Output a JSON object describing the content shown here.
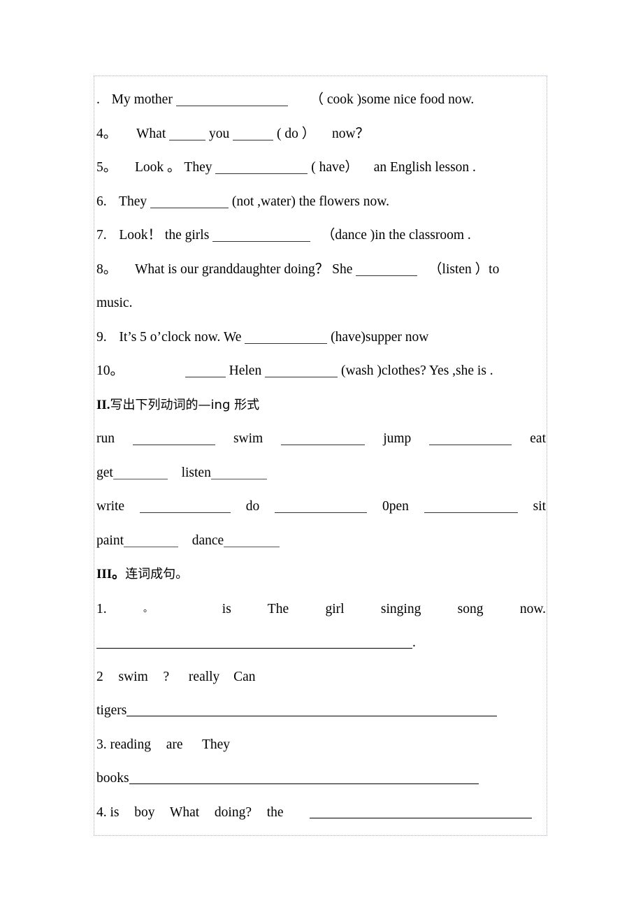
{
  "document": {
    "type": "english-grammar-worksheet",
    "background_color": "#ffffff",
    "text_color": "#000000",
    "border_color": "#b0a8b9"
  },
  "section_one": {
    "items": [
      {
        "number": ".",
        "pre": "My mother",
        "cue": "（ cook )some nice food  now.",
        "blank_width": 160
      },
      {
        "number": "4。",
        "pre": "What",
        "mid": "you",
        "cue": "( do ）",
        "tail": "now？",
        "blank_width": 52,
        "blank2_width": 58
      },
      {
        "number": "5。",
        "pre": "Look 。  They",
        "cue": "( have）",
        "tail": "an English lesson .",
        "blank_width": 132
      },
      {
        "number": "6.",
        "pre": "They",
        "cue": "(not ,water) the flowers now.",
        "blank_width": 112
      },
      {
        "number": "7.",
        "pre": "Look！   the girls",
        "cue": "（dance )in the classroom .",
        "blank_width": 140
      },
      {
        "number": "8。",
        "pre": "What  is  our  granddaughter  doing？   She",
        "cue": "（listen ）to",
        "tail": "music.",
        "blank_width": 88
      },
      {
        "number": "9.",
        "pre": "It’s  5  o’clock now. We",
        "cue": "(have)supper now",
        "blank_width": 118
      },
      {
        "number": "10。",
        "pre": "Helen",
        "cue": "(wash )clothes? Yes ,she is .",
        "blank_width": 58,
        "blank2_width": 104
      }
    ]
  },
  "section_two": {
    "heading_numeral": "II.",
    "heading_text": "写出下列动词的—ing 形式",
    "rows": [
      {
        "words": [
          "run",
          "swim",
          "jump",
          "eat"
        ],
        "blank_widths": [
          118,
          120,
          118,
          0
        ],
        "justified": true
      },
      {
        "words": [
          "get",
          "listen"
        ],
        "blank_widths": [
          78,
          80
        ],
        "justified": false
      },
      {
        "words": [
          "write",
          "do",
          "0pen",
          "sit"
        ],
        "blank_widths": [
          130,
          132,
          134,
          0
        ],
        "justified": true
      },
      {
        "words": [
          "paint",
          "dance"
        ],
        "blank_widths": [
          78,
          80
        ],
        "justified": false
      }
    ]
  },
  "section_three": {
    "heading_numeral": "III。",
    "heading_text": "连词成句。",
    "items": [
      {
        "number": "1. ",
        "scrambled": [
          "。",
          "is",
          "The",
          "girl",
          "singing",
          "song",
          "now."
        ],
        "justified": true,
        "answer_prefix": "",
        "answer_rule_width": 452,
        "answer_suffix": "."
      },
      {
        "number": "2",
        "scrambled": [
          "swim",
          "?",
          "really",
          "Can"
        ],
        "justified": false,
        "answer_prefix": "tigers",
        "answer_rule_width": 530,
        "answer_suffix": ""
      },
      {
        "number": "3.",
        "scrambled": [
          "reading",
          "are",
          "They"
        ],
        "justified": false,
        "answer_prefix": "books",
        "answer_rule_width": 500,
        "answer_suffix": ""
      },
      {
        "number": "4.",
        "scrambled": [
          "is",
          "boy",
          "What",
          "doing?",
          "the"
        ],
        "justified": false,
        "answer_prefix": "",
        "answer_rule_width": 318,
        "answer_suffix": ""
      }
    ]
  }
}
